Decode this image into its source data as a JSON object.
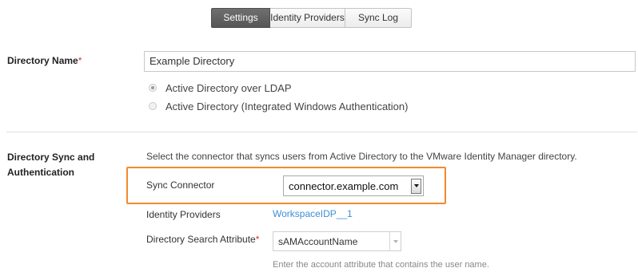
{
  "tabs": [
    {
      "label": "Settings",
      "active": true
    },
    {
      "label": "Identity Providers",
      "active": false
    },
    {
      "label": "Sync Log",
      "active": false
    }
  ],
  "directory_name": {
    "label": "Directory Name",
    "required_marker": "*",
    "value": "Example Directory",
    "options": [
      {
        "label": "Active Directory over LDAP",
        "selected": true
      },
      {
        "label": "Active Directory (Integrated Windows Authentication)",
        "selected": false
      }
    ]
  },
  "sync": {
    "label_line1": "Directory Sync and",
    "label_line2": "Authentication",
    "description": "Select the connector that syncs users from Active Directory to the VMware Identity Manager directory.",
    "connector_label": "Sync Connector",
    "connector_value": "connector.example.com",
    "idp_label": "Identity Providers",
    "idp_link": "WorkspaceIDP__1",
    "search_attr_label": "Directory Search Attribute",
    "search_attr_required": "*",
    "search_attr_value": "sAMAccountName",
    "search_attr_hint": "Enter the account attribute that contains the user name."
  },
  "colors": {
    "highlight_border": "#f28a2e",
    "link": "#3f8fd2",
    "required": "#d9342b",
    "active_tab_bg": "#5e5e5e"
  },
  "icons": {
    "select_arrow": "chevron-down-icon",
    "radio": "radio-icon"
  }
}
